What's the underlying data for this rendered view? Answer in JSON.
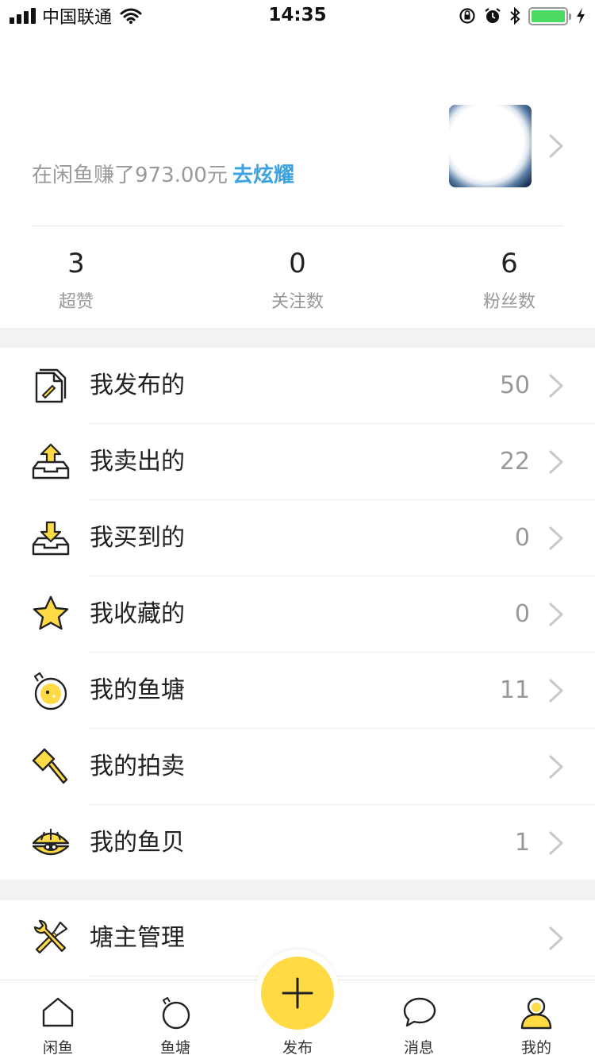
{
  "status_bar": {
    "carrier": "中国联通",
    "time": "14:35"
  },
  "profile": {
    "earned_text": "在闲鱼赚了973.00元",
    "show_off_link": "去炫耀",
    "stats": [
      {
        "value": "3",
        "label": "超赞"
      },
      {
        "value": "0",
        "label": "关注数"
      },
      {
        "value": "6",
        "label": "粉丝数"
      }
    ]
  },
  "menu": [
    {
      "label": "我发布的",
      "count": "50",
      "icon": "published-doc-icon"
    },
    {
      "label": "我卖出的",
      "count": "22",
      "icon": "tray-upload-icon"
    },
    {
      "label": "我买到的",
      "count": "0",
      "icon": "tray-download-icon"
    },
    {
      "label": "我收藏的",
      "count": "0",
      "icon": "star-icon"
    },
    {
      "label": "我的鱼塘",
      "count": "11",
      "icon": "fish-pond-icon"
    },
    {
      "label": "我的拍卖",
      "count": "",
      "icon": "auction-hammer-icon"
    },
    {
      "label": "我的鱼贝",
      "count": "1",
      "icon": "shell-icon"
    }
  ],
  "menu2": [
    {
      "label": "塘主管理",
      "count": "",
      "icon": "wrench-screwdriver-icon"
    }
  ],
  "tabbar": {
    "tabs": [
      {
        "label": "闲鱼",
        "icon": "home-icon"
      },
      {
        "label": "鱼塘",
        "icon": "pond-icon"
      },
      {
        "label": "发布",
        "icon": "plus-icon"
      },
      {
        "label": "消息",
        "icon": "chat-bubble-icon"
      },
      {
        "label": "我的",
        "icon": "user-icon"
      }
    ]
  },
  "colors": {
    "accent_yellow": "#ffda44",
    "link_blue": "#3ba3e0",
    "battery_green": "#4cd964"
  }
}
